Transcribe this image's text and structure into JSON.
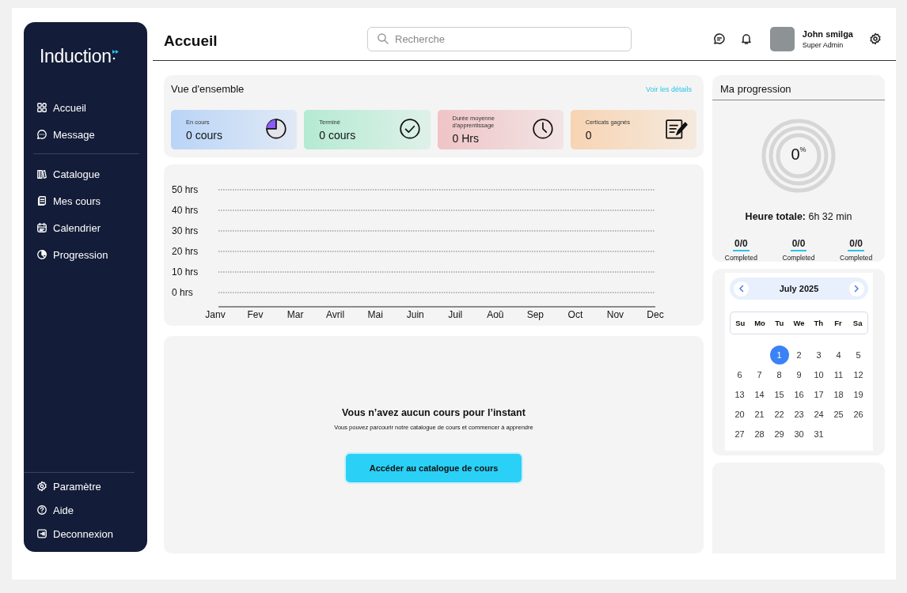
{
  "sidebar": {
    "logo": "Induction",
    "sections": [
      [
        {
          "label": "Accueil"
        },
        {
          "label": "Message"
        }
      ],
      [
        {
          "label": "Catalogue"
        },
        {
          "label": "Mes cours"
        },
        {
          "label": "Calendrier"
        },
        {
          "label": "Progression"
        }
      ]
    ],
    "bottom_items": [
      {
        "label": "Paramètre"
      },
      {
        "label": "Aide"
      },
      {
        "label": "Deconnexion"
      }
    ]
  },
  "header": {
    "title": "Accueil",
    "search": {
      "placeholder": "Recherche"
    },
    "user": {
      "name": "John smilga",
      "role": "Super Admin"
    }
  },
  "overview": {
    "title": "Vue d'ensemble",
    "link": "Voir les détails",
    "cards": [
      {
        "kind": "in_progress",
        "label": "En cours",
        "value": "0 cours",
        "color": "#b9d4f7"
      },
      {
        "kind": "completed",
        "label": "Terminé",
        "value": "0 cours",
        "color": "#b4ead2"
      },
      {
        "kind": "duration",
        "label": "Durée moyenne d'apprentissage",
        "value": "0 Hrs",
        "color": "#efc4c6"
      },
      {
        "kind": "certificates",
        "label": "Certicats gagnés",
        "value": "0",
        "color": "#f7d4b3"
      }
    ]
  },
  "activity": {
    "chart_data": {
      "type": "line",
      "grid": true,
      "categories": [
        "Janv",
        "Fev",
        "Mar",
        "Avril",
        "Mai",
        "Juin",
        "Juil",
        "Aoû",
        "Sep",
        "Oct",
        "Nov",
        "Dec"
      ],
      "ylim": [
        0,
        50
      ],
      "yticks": [
        {
          "value": 50,
          "label": "50 hrs"
        },
        {
          "value": 40,
          "label": "40 hrs"
        },
        {
          "value": 30,
          "label": "30 hrs"
        },
        {
          "value": 20,
          "label": "20 hrs"
        },
        {
          "value": 10,
          "label": "10 hrs"
        },
        {
          "value": 0,
          "label": "0 hrs"
        }
      ]
    }
  },
  "empty_state": {
    "title": "Vous n’avez aucun cours pour l’instant",
    "text": "Vous pouvez parcourir notre catalogue de cours et commencer à apprendre",
    "button": "Accéder au catalogue de cours"
  },
  "progress": {
    "title": "Ma progression",
    "percent": "0",
    "unit": "%",
    "level": 0,
    "total_label": "Heure totale:",
    "total_value": "6h 32 min",
    "stats": [
      {
        "value": "0/0",
        "label": "Completed"
      },
      {
        "value": "0/0",
        "label": "Completed"
      },
      {
        "value": "0/0",
        "label": "Completed"
      }
    ]
  },
  "calendar": {
    "month": "July 2025",
    "weekdays": [
      "Su",
      "Mo",
      "Tu",
      "We",
      "Th",
      "Fr",
      "Sa"
    ],
    "weeks": [
      [
        {
          "label": "1",
          "selected": true
        },
        {
          "label": "2",
          "selected": false
        },
        {
          "label": "3",
          "selected": false
        },
        {
          "label": "4",
          "selected": false
        },
        {
          "label": "5",
          "selected": false
        }
      ],
      [
        {
          "label": "6",
          "selected": false
        },
        {
          "label": "7",
          "selected": false
        },
        {
          "label": "8",
          "selected": false
        },
        {
          "label": "9",
          "selected": false
        },
        {
          "label": "10",
          "selected": false
        },
        {
          "label": "11",
          "selected": false
        },
        {
          "label": "12",
          "selected": false
        }
      ],
      [
        {
          "label": "13",
          "selected": false
        },
        {
          "label": "14",
          "selected": false
        },
        {
          "label": "15",
          "selected": false
        },
        {
          "label": "16",
          "selected": false
        },
        {
          "label": "17",
          "selected": false
        },
        {
          "label": "18",
          "selected": false
        },
        {
          "label": "19",
          "selected": false
        }
      ],
      [
        {
          "label": "20",
          "selected": false
        },
        {
          "label": "21",
          "selected": false
        },
        {
          "label": "22",
          "selected": false
        },
        {
          "label": "23",
          "selected": false
        },
        {
          "label": "24",
          "selected": false
        },
        {
          "label": "25",
          "selected": false
        },
        {
          "label": "26",
          "selected": false
        }
      ],
      [
        {
          "label": "27",
          "selected": false
        },
        {
          "label": "28",
          "selected": false
        },
        {
          "label": "29",
          "selected": false
        },
        {
          "label": "30",
          "selected": false
        },
        {
          "label": "31",
          "selected": false
        }
      ]
    ]
  }
}
